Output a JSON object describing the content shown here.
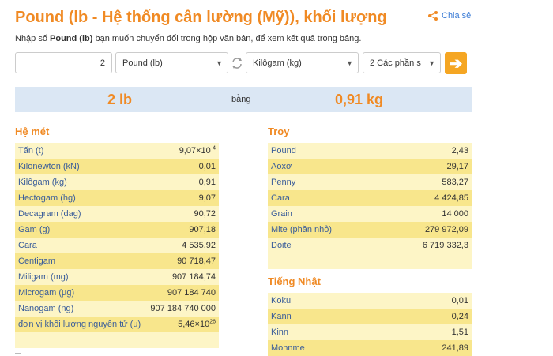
{
  "title": "Pound (lb - Hệ thống cân lường (Mỹ)), khối lượng",
  "share_label": "Chia sẻ",
  "intro": {
    "before": "Nhập số ",
    "bold": "Pound (lb)",
    "after": " bạn muốn chuyển đổi trong hộp văn bản, để xem kết quả trong bảng."
  },
  "converter": {
    "input_value": "2",
    "from_unit": "Pound (lb)",
    "to_unit": "Kilôgam (kg)",
    "precision": "2 Các phần s"
  },
  "result": {
    "lhs": "2 lb",
    "mid": "bằng",
    "rhs": "0,91 kg"
  },
  "metric": {
    "title": "Hệ mét",
    "rows": [
      {
        "name": "Tấn (t)",
        "value": "9,07×10",
        "exp": "-4"
      },
      {
        "name": "Kilonewton (kN)",
        "value": "0,01"
      },
      {
        "name": "Kilôgam (kg)",
        "value": "0,91"
      },
      {
        "name": "Hectogam (hg)",
        "value": "9,07"
      },
      {
        "name": "Decagram (dag)",
        "value": "90,72"
      },
      {
        "name": "Gam (g)",
        "value": "907,18"
      },
      {
        "name": "Cara",
        "value": "4 535,92"
      },
      {
        "name": "Centigam",
        "value": "90 718,47"
      },
      {
        "name": "Miligam (mg)",
        "value": "907 184,74"
      },
      {
        "name": "Microgam (µg)",
        "value": "907 184 740"
      },
      {
        "name": "Nanogam (ng)",
        "value": "907 184 740 000"
      },
      {
        "name": "đơn vị khối lượng nguyên tử (u)",
        "value": "5,46×10",
        "exp": "26"
      }
    ]
  },
  "troy": {
    "title": "Troy",
    "rows": [
      {
        "name": "Pound",
        "value": "2,43"
      },
      {
        "name": "Aoxơ",
        "value": "29,17"
      },
      {
        "name": "Penny",
        "value": "583,27"
      },
      {
        "name": "Cara",
        "value": "4 424,85"
      },
      {
        "name": "Grain",
        "value": "14 000"
      },
      {
        "name": "Mite (phần nhỏ)",
        "value": "279 972,09"
      },
      {
        "name": "Doite",
        "value": "6 719 332,3"
      }
    ]
  },
  "japan": {
    "title": "Tiếng Nhật",
    "rows": [
      {
        "name": "Koku",
        "value": "0,01"
      },
      {
        "name": "Kann",
        "value": "0,24"
      },
      {
        "name": "Kinn",
        "value": "1,51"
      },
      {
        "name": "Monnme",
        "value": "241,89"
      }
    ]
  }
}
